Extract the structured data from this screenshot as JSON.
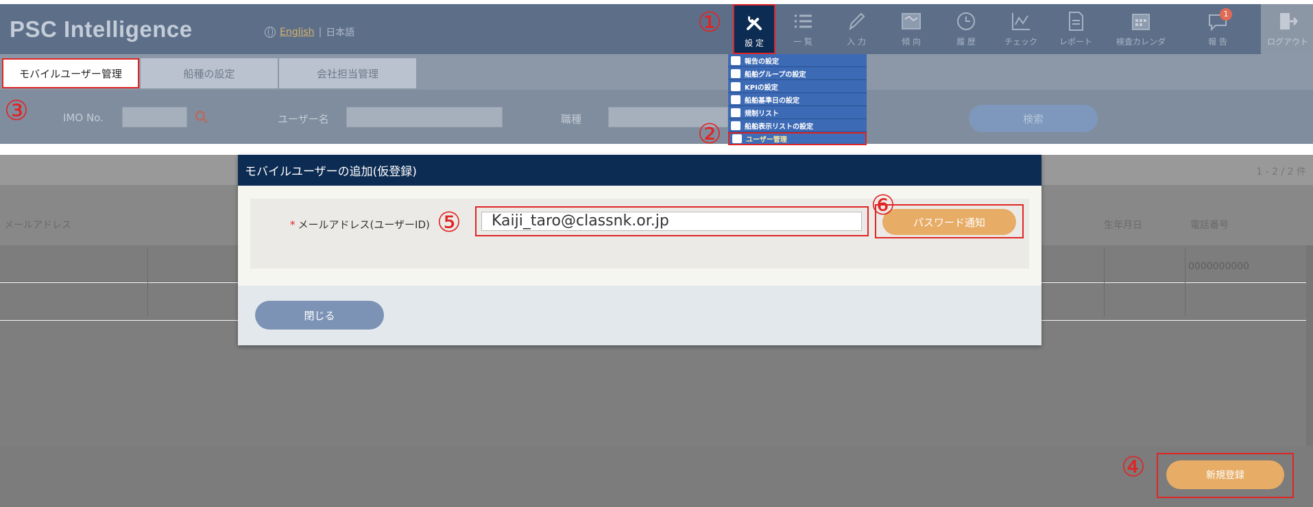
{
  "header": {
    "logo": "PSC Intelligence",
    "lang_english": "English",
    "lang_separator": "|",
    "lang_japanese": "日本語"
  },
  "nav": [
    {
      "id": "settings",
      "label": "設 定",
      "icon": "tools-icon"
    },
    {
      "id": "list",
      "label": "一 覧",
      "icon": "list-icon"
    },
    {
      "id": "input",
      "label": "入 力",
      "icon": "pencil-icon"
    },
    {
      "id": "trend",
      "label": "傾 向",
      "icon": "map-icon"
    },
    {
      "id": "history",
      "label": "履 歴",
      "icon": "clock-icon"
    },
    {
      "id": "check",
      "label": "チェック",
      "icon": "line-chart-icon"
    },
    {
      "id": "report",
      "label": "レポート",
      "icon": "document-icon"
    },
    {
      "id": "calendar",
      "label": "検査カレンダ",
      "icon": "calendar-icon"
    },
    {
      "id": "notice",
      "label": "報 告",
      "icon": "chat-bubble-icon",
      "badge": "1"
    },
    {
      "id": "logout",
      "label": "ログアウト",
      "icon": "logout-icon"
    }
  ],
  "dropdown": [
    {
      "label": "報告の設定",
      "icon": "mail-icon"
    },
    {
      "label": "船舶グループの設定",
      "icon": "ship-icon"
    },
    {
      "label": "KPIの設定",
      "icon": "function-icon"
    },
    {
      "label": "船舶基準日の設定",
      "icon": "ship-icon"
    },
    {
      "label": "規制リスト",
      "icon": "edit-icon"
    },
    {
      "label": "船舶表示リストの設定",
      "icon": "ship-icon"
    },
    {
      "label": "ユーザー管理",
      "icon": "user-icon"
    }
  ],
  "tabs": {
    "mobile_user": "モバイルユーザー管理",
    "ship_type": "船種の設定",
    "company": "会社担当管理"
  },
  "search": {
    "imo_label": "IMO No.",
    "user_label": "ユーザー名",
    "type_label": "職種",
    "button": "検索"
  },
  "table": {
    "count": "1 - 2 / 2 件",
    "headers": {
      "email": "メールアドレス",
      "birthday": "生年月日",
      "phone": "電話番号"
    },
    "rows": [
      {
        "phone": "0000000000"
      },
      {
        "phone": ""
      }
    ]
  },
  "footer": {
    "new_button": "新規登録"
  },
  "modal": {
    "title": "モバイルユーザーの追加(仮登録)",
    "required_mark": "*",
    "field_label": "メールアドレス(ユーザーID)",
    "email_value": "Kaiji_taro@classnk.or.jp",
    "notify_button": "パスワード通知",
    "close_button": "閉じる"
  },
  "callouts": {
    "c1": "①",
    "c2": "②",
    "c3": "③",
    "c4": "④",
    "c5": "⑤",
    "c6": "⑥"
  },
  "colors": {
    "header_bg": "#5d6f88",
    "modal_header": "#0d2c53",
    "accent_orange": "#e7ac66",
    "highlight_red": "#e02424"
  }
}
